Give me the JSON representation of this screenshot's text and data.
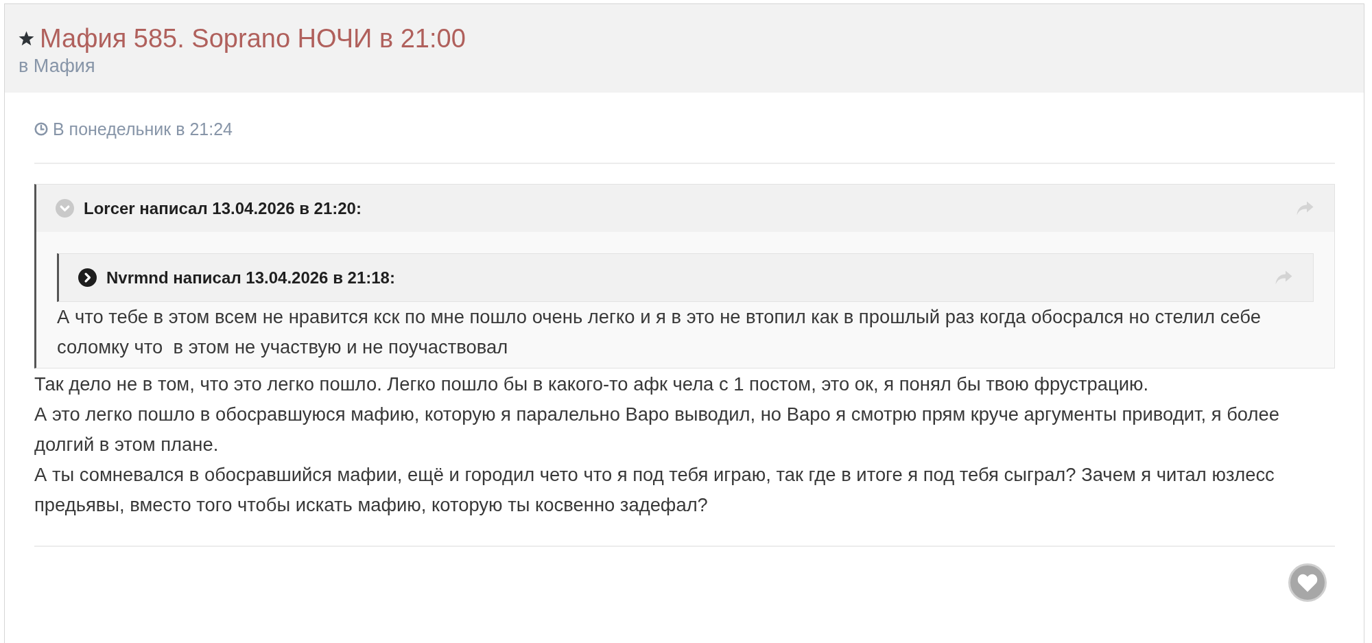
{
  "thread": {
    "title": "Мафия 585. Soprano НОЧИ в 21:00",
    "forum": "в Мафия"
  },
  "post": {
    "date": "В понедельник в 21:24",
    "quote": {
      "header": "Lorcer написал 13.04.2026 в 21:20:",
      "expanded": true,
      "quote": {
        "header": "Nvrmnd написал 13.04.2026 в 21:18:",
        "expanded": false
      },
      "text": "А что тебе в этом всем не нравится кск по мне пошло очень легко и я в это не втопил как в прошлый раз когда обосрался но стелил себе соломку что  в этом не участвую и не поучаствовал"
    },
    "lines": [
      "Так дело не в том, что это легко пошло. Легко пошло бы в какого-то афк чела с 1 постом, это ок, я понял бы твою фрустрацию.",
      "А это легко пошло в обосравшуюся мафию, которую я паралельно Варо выводил, но Варо я смотрю прям круче аргументы приводит, я более долгий в этом плане.",
      "А ты сомневался в обосравшийся мафии, ещё и городил чето что я под тебя играю, так где в итоге я под тебя сыграл? Зачем я читал юзлесс предьявы, вместо того чтобы искать мафию, которую ты косвенно задефал?"
    ]
  }
}
